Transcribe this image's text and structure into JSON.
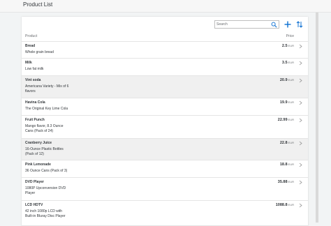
{
  "header": {
    "title": "Product List"
  },
  "toolbar": {
    "search_placeholder": "Search",
    "search_value": "",
    "search_icon": "search-icon",
    "add_icon": "add-icon",
    "sort_icon": "sort-icon"
  },
  "columns": {
    "product": "Product",
    "price": "Price"
  },
  "products": [
    {
      "name": "Bread",
      "desc": "Whole grain bread",
      "price": "2.5",
      "currency": "EUR"
    },
    {
      "name": "Milk",
      "desc": "Low fat milk",
      "price": "3.5",
      "currency": "EUR"
    },
    {
      "name": "Vint soda",
      "desc": "Americana Variety - Mix of 6 flavors",
      "price": "20.9",
      "currency": "EUR"
    },
    {
      "name": "Havina Cola",
      "desc": "The Original Key Lime Cola",
      "price": "19.9",
      "currency": "EUR"
    },
    {
      "name": "Fruit Punch",
      "desc": "Mango flavor, 8.3 Ounce Cans (Pack of 24)",
      "price": "22.99",
      "currency": "EUR"
    },
    {
      "name": "Cranberry Juice",
      "desc": "16-Ounce Plastic Bottles (Pack of 12)",
      "price": "22.8",
      "currency": "EUR"
    },
    {
      "name": "Pink Lemonade",
      "desc": "36 Ounce Cans (Pack of 3)",
      "price": "18.8",
      "currency": "EUR"
    },
    {
      "name": "DVD Player",
      "desc": "1080P Upconversion DVD Player",
      "price": "35.88",
      "currency": "EUR"
    },
    {
      "name": "LCD HDTV",
      "desc": "42 inch 1080p LCD with Built-in Bluray Disc Player",
      "price": "1088.8",
      "currency": "EUR"
    }
  ],
  "colors": {
    "selected_row": "#f0f0f0",
    "accent": "#0a6ed1",
    "divider": "#e5e5e5"
  }
}
